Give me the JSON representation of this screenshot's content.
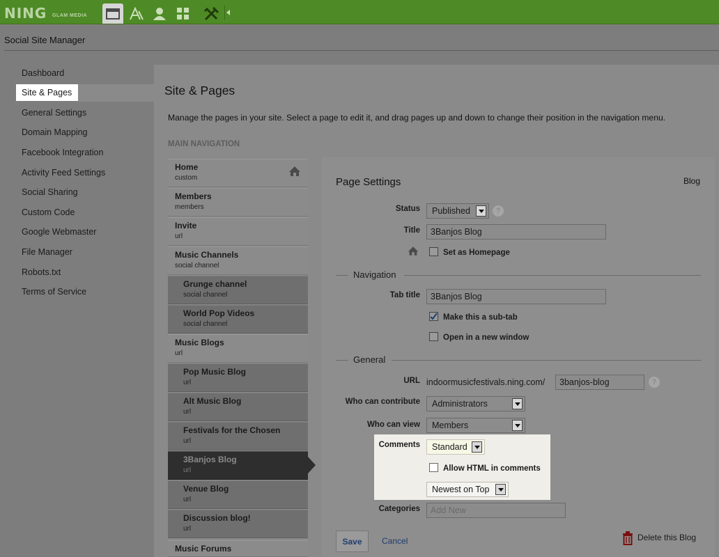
{
  "topbar": {
    "logo": "NING",
    "logo_sub": "GLAM MEDIA",
    "icons": [
      "window-icon",
      "text-style-icon",
      "user-icon",
      "grid-icon",
      "tools-icon"
    ],
    "bg_color": "#4e8a25"
  },
  "header": {
    "title": "Social Site Manager"
  },
  "sidebar": {
    "items": [
      {
        "label": "Dashboard"
      },
      {
        "label": "Site & Pages",
        "active": true
      },
      {
        "label": "General Settings"
      },
      {
        "label": "Domain Mapping"
      },
      {
        "label": "Facebook Integration"
      },
      {
        "label": "Activity Feed Settings"
      },
      {
        "label": "Social Sharing"
      },
      {
        "label": "Custom Code"
      },
      {
        "label": "Google Webmaster"
      },
      {
        "label": "File Manager"
      },
      {
        "label": "Robots.txt"
      },
      {
        "label": "Terms of Service"
      }
    ]
  },
  "main": {
    "title": "Site & Pages",
    "description": "Manage the pages in your site. Select a page to edit it, and drag pages up and down to change their position in the navigation menu.",
    "nav_heading": "MAIN NAVIGATION",
    "pages": [
      {
        "name": "Home",
        "type": "custom",
        "sub": false,
        "home": true
      },
      {
        "name": "Members",
        "type": "members",
        "sub": false
      },
      {
        "name": "Invite",
        "type": "url",
        "sub": false
      },
      {
        "name": "Music Channels",
        "type": "social channel",
        "sub": false
      },
      {
        "name": "Grunge channel",
        "type": "social channel",
        "sub": true
      },
      {
        "name": "World Pop Videos",
        "type": "social channel",
        "sub": true
      },
      {
        "name": "Music Blogs",
        "type": "url",
        "sub": false
      },
      {
        "name": "Pop Music Blog",
        "type": "url",
        "sub": true
      },
      {
        "name": "Alt Music Blog",
        "type": "url",
        "sub": true
      },
      {
        "name": "Festivals for the Chosen",
        "type": "url",
        "sub": true
      },
      {
        "name": "3Banjos Blog",
        "type": "url",
        "sub": true,
        "selected": true
      },
      {
        "name": "Venue Blog",
        "type": "url",
        "sub": true
      },
      {
        "name": "Discussion blog!",
        "type": "url",
        "sub": true
      },
      {
        "name": "Music Forums",
        "type": "",
        "sub": false
      }
    ]
  },
  "settings": {
    "heading": "Page Settings",
    "page_type": "Blog",
    "status_label": "Status",
    "status_value": "Published",
    "title_label": "Title",
    "title_value": "3Banjos Blog",
    "homepage_label": "Set as Homepage",
    "navigation_heading": "Navigation",
    "tab_title_label": "Tab title",
    "tab_title_value": "3Banjos Blog",
    "subtab_label": "Make this a sub-tab",
    "subtab_checked": true,
    "new_window_label": "Open in a new window",
    "general_heading": "General",
    "url_label": "URL",
    "url_prefix": "indoormusicfestivals.ning.com/",
    "url_value": "3banjos-blog",
    "contribute_label": "Who can contribute",
    "contribute_value": "Administrators",
    "view_label": "Who can view",
    "view_value": "Members",
    "comments_label": "Comments",
    "comments_value": "Standard",
    "allow_html_label": "Allow HTML in comments",
    "order_value": "Newest on Top",
    "categories_label": "Categories",
    "categories_placeholder": "Add New",
    "save_label": "Save",
    "cancel_label": "Cancel",
    "delete_label": "Delete this Blog"
  }
}
